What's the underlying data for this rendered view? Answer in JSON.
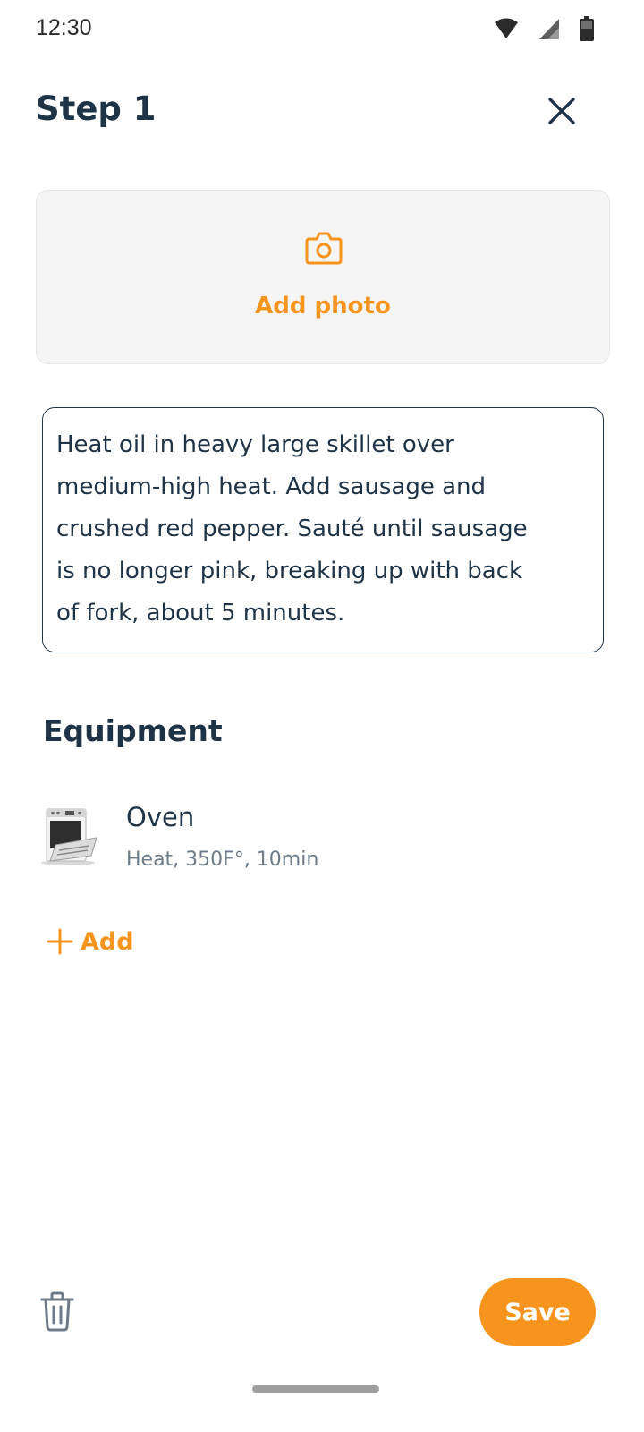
{
  "status_bar": {
    "time": "12:30",
    "icons": [
      "wifi-icon",
      "cellular-signal-icon",
      "battery-icon"
    ]
  },
  "header": {
    "title": "Step 1",
    "close_icon": "close-icon"
  },
  "photo": {
    "icon": "camera-icon",
    "label": "Add photo"
  },
  "description": {
    "lines": [
      "Heat oil in heavy large skillet over",
      "medium-high heat. Add sausage and",
      "crushed red pepper. Sauté until sausage",
      "is no longer pink, breaking up with back",
      "of fork, about 5 minutes."
    ]
  },
  "equipment": {
    "heading": "Equipment",
    "items": [
      {
        "image": "oven-image",
        "name": "Oven",
        "detail": "Heat, 350F°, 10min"
      }
    ],
    "add_label": "Add",
    "add_icon": "plus-icon"
  },
  "footer": {
    "delete_icon": "trash-icon",
    "save_label": "Save"
  },
  "colors": {
    "accent": "#f7941d",
    "text_primary": "#1f3346",
    "text_secondary": "#6d7b88",
    "card_background": "#f5f5f5"
  }
}
